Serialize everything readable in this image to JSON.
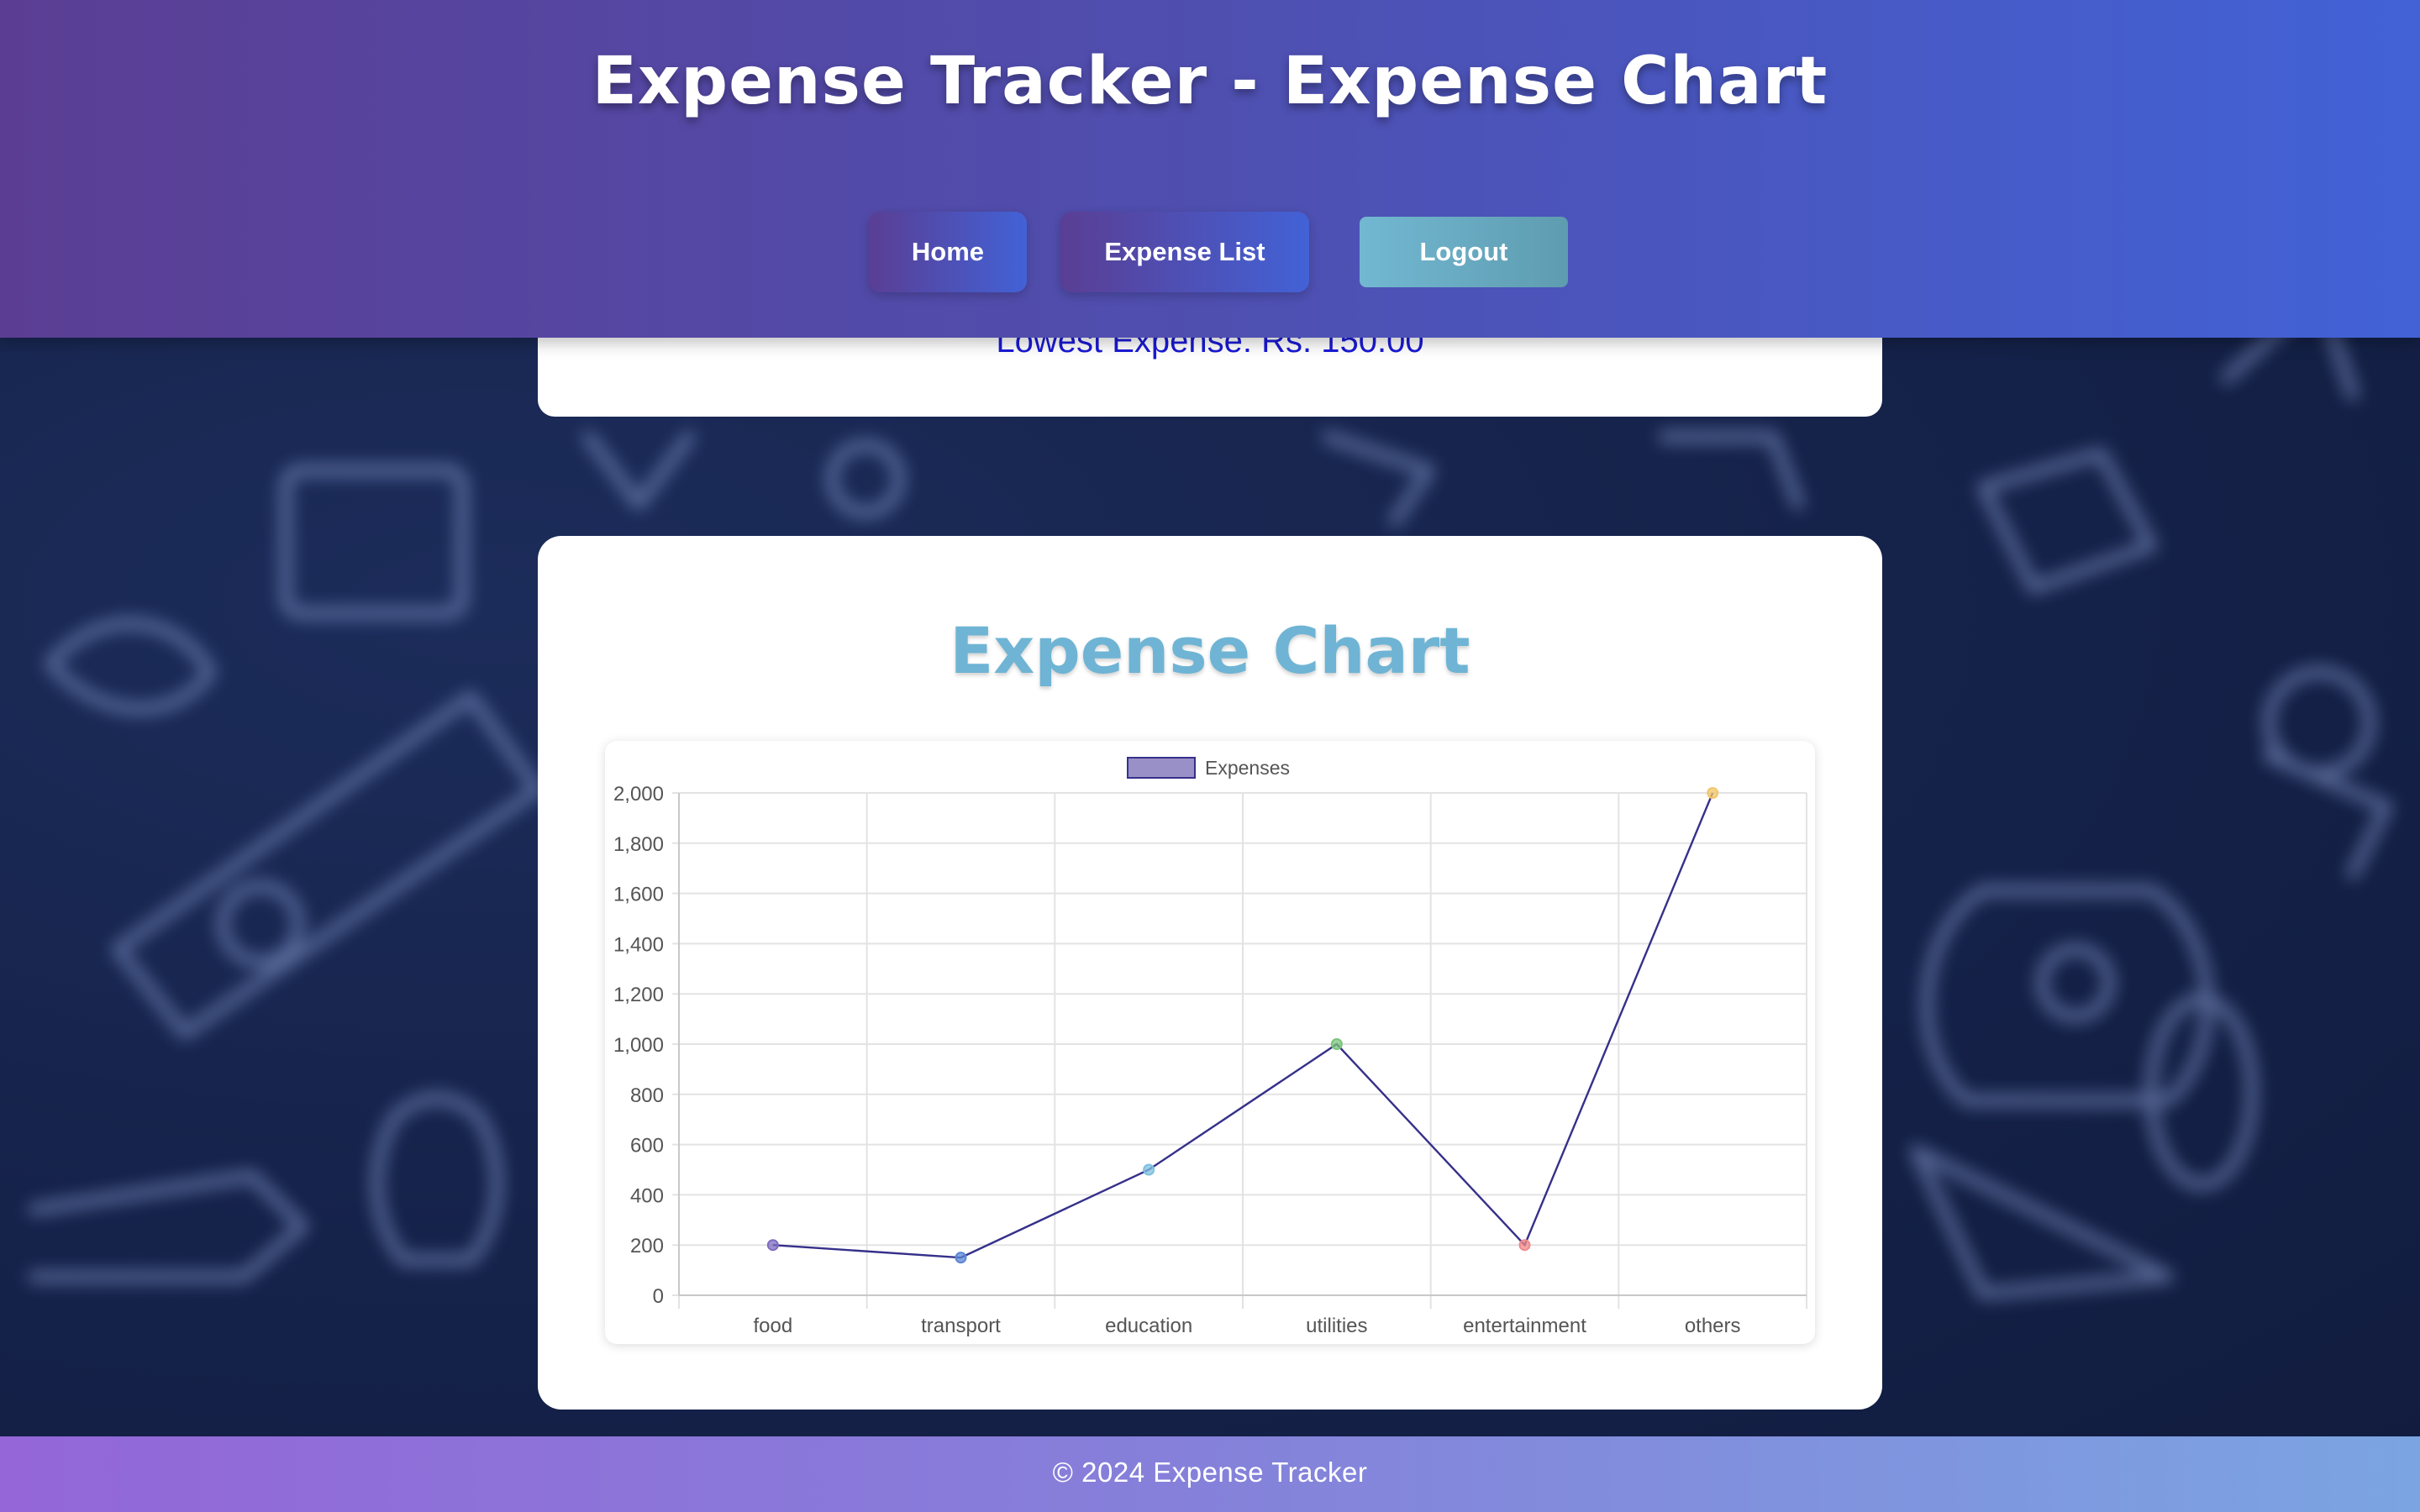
{
  "header": {
    "title": "Expense Tracker - Expense Chart",
    "nav": {
      "home_label": "Home",
      "expense_list_label": "Expense List",
      "logout_label": "Logout"
    }
  },
  "summary": {
    "lowest_expense": "Lowest Expense: Rs. 150.00"
  },
  "chart_section": {
    "heading": "Expense Chart"
  },
  "chart_data": {
    "type": "line",
    "title": "",
    "xlabel": "",
    "ylabel": "",
    "categories": [
      "food",
      "transport",
      "education",
      "utilities",
      "entertainment",
      "others"
    ],
    "series": [
      {
        "name": "Expenses",
        "values": [
          200,
          150,
          500,
          1000,
          200,
          2000
        ],
        "line_color": "#36308a",
        "legend_fill": "#9a90c8",
        "point_colors": [
          "#7e6cc0",
          "#5b86d6",
          "#7fc0e0",
          "#7cc47c",
          "#f08a8a",
          "#f2c66a"
        ]
      }
    ],
    "ylim": [
      0,
      2000
    ],
    "yticks": [
      0,
      200,
      400,
      600,
      800,
      1000,
      1200,
      1400,
      1600,
      1800,
      2000
    ],
    "ytick_labels": [
      "0",
      "200",
      "400",
      "600",
      "800",
      "1,000",
      "1,200",
      "1,400",
      "1,600",
      "1,800",
      "2,000"
    ],
    "grid": true,
    "legend": "top-center"
  },
  "footer": {
    "text": "© 2024 Expense Tracker"
  },
  "colors": {
    "header_start": "#5b3e94",
    "header_end": "#4262d6",
    "accent_heading": "#6fb4d4",
    "lowest_text": "#1a1ad6",
    "logout_button": "#72b8d2"
  }
}
